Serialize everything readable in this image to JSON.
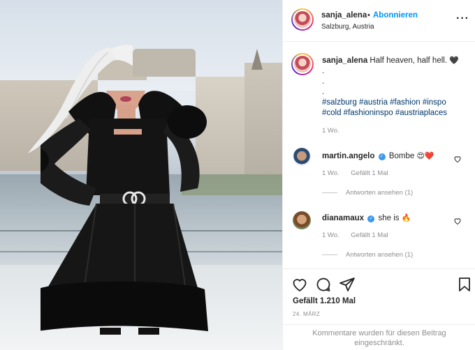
{
  "post": {
    "username": "sanja_alena",
    "separator": "•",
    "follow_label": "Abonnieren",
    "location": "Salzburg, Austria",
    "more_icon": "more-horizontal-icon"
  },
  "caption": {
    "username": "sanja_alena",
    "text": "Half heaven, half hell.",
    "emoji": "🖤",
    "dot1": ".",
    "dot2": ".",
    "dot3": ".",
    "hashtags_line1": "#salzburg #austria #fashion #inspo",
    "hashtags_line2": "#cold #fashioninspo #austriaplaces",
    "age": "1 Wo."
  },
  "comments": [
    {
      "username": "martin.angelo",
      "text": "Bombe",
      "emoji": "😍❤️",
      "age": "1 Wo.",
      "likes": "Gefällt 1 Mal",
      "replies": "Antworten ansehen (1)"
    },
    {
      "username": "dianamaux",
      "text": "she is",
      "emoji": "🔥",
      "age": "1 Wo.",
      "likes": "Gefällt 1 Mal",
      "replies": "Antworten ansehen (1)"
    }
  ],
  "actions": {
    "like_icon": "heart-icon",
    "comment_icon": "comment-icon",
    "share_icon": "share-icon",
    "save_icon": "bookmark-icon",
    "likes_text": "Gefällt 1.210 Mal",
    "date": "24. März"
  },
  "footer": {
    "restricted_line1": "Kommentare wurden für diesen Beitrag",
    "restricted_line2": "eingeschränkt."
  },
  "colors": {
    "link_blue": "#0095f6",
    "hashtag": "#00376b",
    "muted": "#8e8e8e",
    "heart_red": "#ed4956"
  }
}
